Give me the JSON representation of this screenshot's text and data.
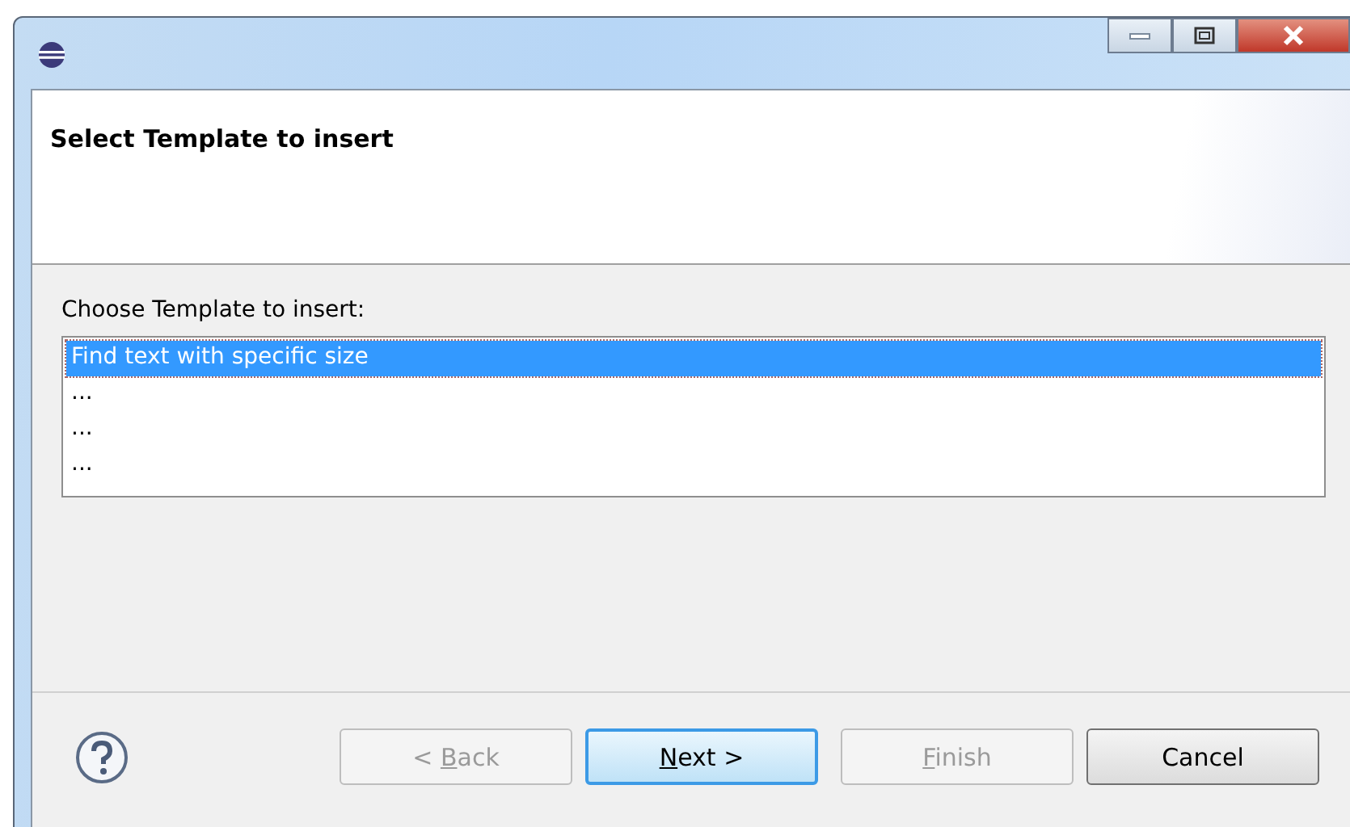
{
  "window": {
    "title_bar": {
      "controls": [
        {
          "kind": "minimize"
        },
        {
          "kind": "maximize"
        },
        {
          "kind": "close"
        }
      ]
    }
  },
  "header": {
    "title": "Select Template to insert"
  },
  "body": {
    "label": "Choose Template to insert:",
    "items": [
      {
        "text": "Find text with specific size",
        "selected": true
      },
      {
        "text": "...",
        "selected": false
      },
      {
        "text": "...",
        "selected": false
      },
      {
        "text": "...",
        "selected": false
      }
    ]
  },
  "buttons": [
    {
      "before": "< ",
      "key": "B",
      "after": "ack",
      "disabled": true,
      "default": false
    },
    {
      "key": "N",
      "after": "ext >",
      "disabled": false,
      "default": true
    },
    {
      "key": "F",
      "after": "inish",
      "disabled": true,
      "default": false
    },
    {
      "after": "Cancel",
      "disabled": false,
      "default": false
    }
  ]
}
